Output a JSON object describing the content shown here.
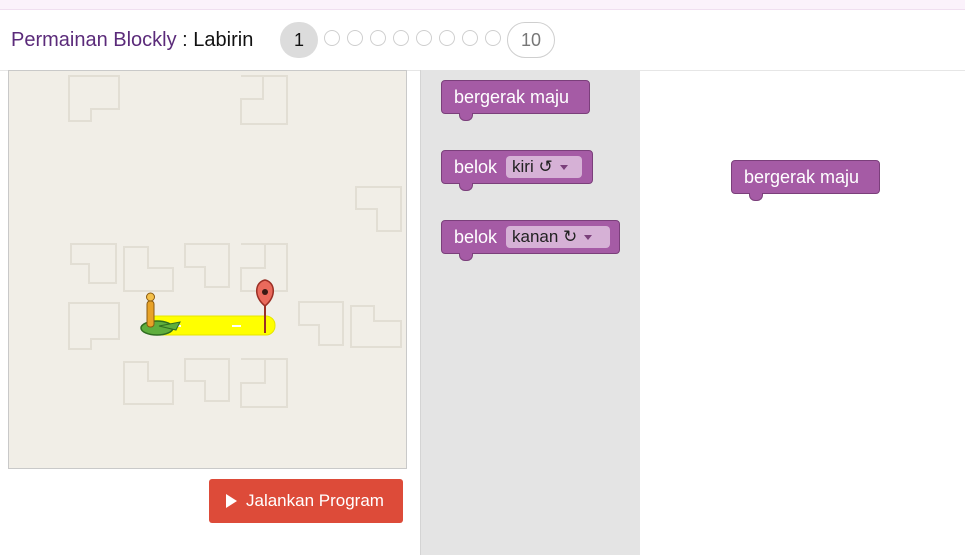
{
  "header": {
    "app_title": "Permainan Blockly",
    "separator": " : ",
    "page_title": "Labirin",
    "levels": {
      "current": "1",
      "last": "10",
      "intermediate_count": 8
    }
  },
  "run_button": {
    "label": "Jalankan Program",
    "icon": "play-icon"
  },
  "toolbox": {
    "blocks": [
      {
        "label": "bergerak maju"
      },
      {
        "label": "belok",
        "dropdown": "kiri ↺"
      },
      {
        "label": "belok",
        "dropdown": "kanan ↻"
      }
    ]
  },
  "workspace": {
    "blocks": [
      {
        "label": "bergerak maju"
      }
    ]
  },
  "colors": {
    "block": "#a55ba5",
    "run_button": "#dd4b39",
    "path": "#ffff00",
    "goal_marker": "#ea6a5c",
    "pegman": "#e8a227"
  },
  "maze": {
    "start_icon": "pegman-icon",
    "goal_icon": "goal-marker-icon"
  }
}
